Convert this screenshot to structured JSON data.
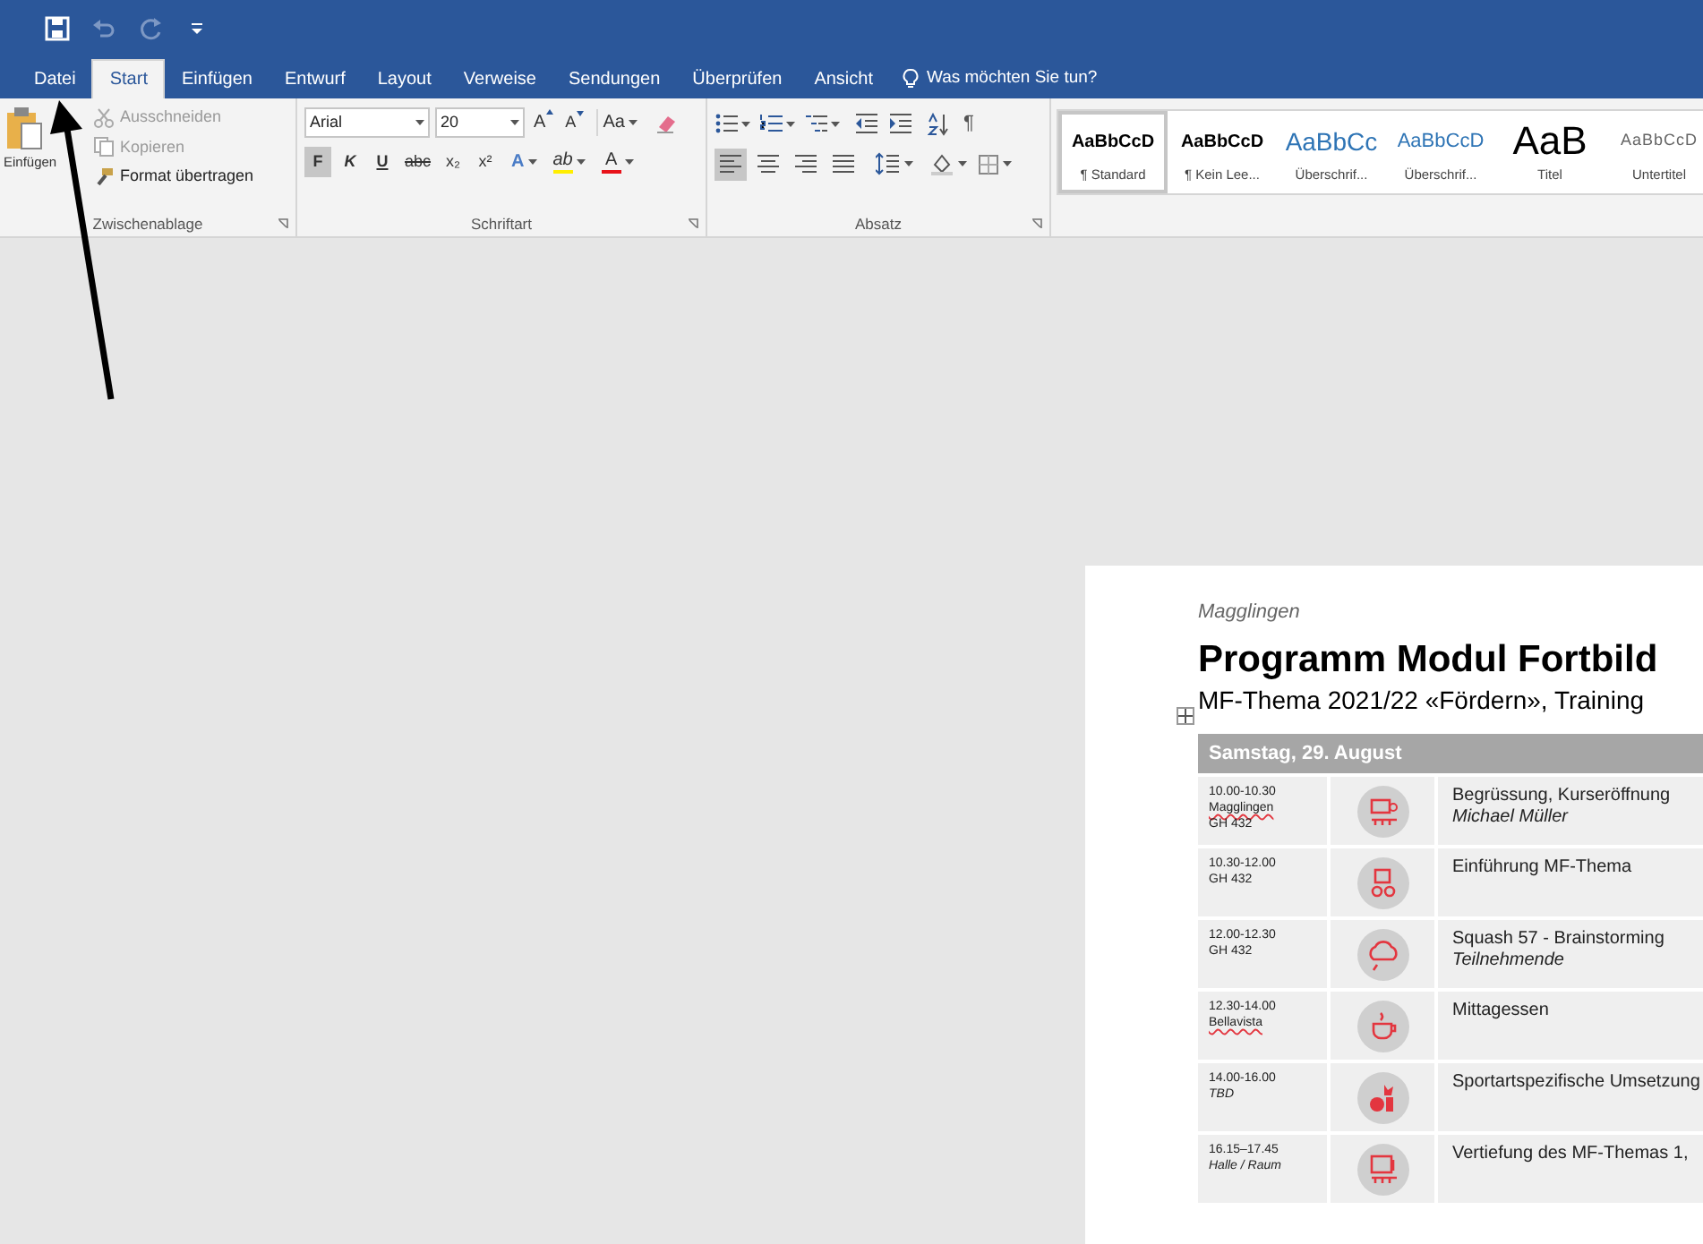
{
  "quick_access": [
    {
      "kind": "save",
      "disabled": false
    },
    {
      "kind": "undo",
      "disabled": true
    },
    {
      "kind": "redo",
      "disabled": true
    },
    {
      "kind": "customize",
      "disabled": false
    }
  ],
  "tabs": [
    {
      "label": "Datei",
      "selected": false
    },
    {
      "label": "Start",
      "selected": true
    },
    {
      "label": "Einfügen",
      "selected": false
    },
    {
      "label": "Entwurf",
      "selected": false
    },
    {
      "label": "Layout",
      "selected": false
    },
    {
      "label": "Verweise",
      "selected": false
    },
    {
      "label": "Sendungen",
      "selected": false
    },
    {
      "label": "Überprüfen",
      "selected": false
    },
    {
      "label": "Ansicht",
      "selected": false
    }
  ],
  "tell_me": "Was möchten Sie tun?",
  "clipboard": {
    "paste": "Einfügen",
    "items": [
      {
        "kind": "cut",
        "label": "Ausschneiden",
        "disabled": true
      },
      {
        "kind": "copy",
        "label": "Kopieren",
        "disabled": true
      },
      {
        "kind": "format_painter",
        "label": "Format übertragen",
        "disabled": false
      }
    ],
    "label": "Zwischenablage"
  },
  "font": {
    "name": "Arial",
    "size": "20",
    "size_buttons": [
      "A",
      "A"
    ],
    "case_button": "Aa",
    "format_buttons": [
      {
        "label": "F",
        "selected": true
      },
      {
        "label": "K",
        "selected": false
      },
      {
        "label": "U",
        "selected": false
      },
      {
        "label": "abc",
        "selected": false
      },
      {
        "label": "x₂",
        "selected": false
      },
      {
        "label": "x²",
        "selected": false
      }
    ],
    "effect_buttons": [
      {
        "kind": "text_effects",
        "label": "A"
      },
      {
        "kind": "highlight",
        "label": "ab"
      },
      {
        "kind": "font_color",
        "label": "A"
      }
    ],
    "label": "Schriftart"
  },
  "paragraph": {
    "show_marks": "¶",
    "alignments": [
      {
        "kind": "left",
        "selected": true
      },
      {
        "kind": "center",
        "selected": false
      },
      {
        "kind": "right",
        "selected": false
      },
      {
        "kind": "justify",
        "selected": false
      }
    ],
    "label": "Absatz"
  },
  "styles": [
    {
      "kind": "normal",
      "preview": "AaBbCcD",
      "name": "¶ Standard",
      "selected": true
    },
    {
      "kind": "no_spacing",
      "preview": "AaBbCcD",
      "name": "¶ Kein Lee...",
      "selected": false
    },
    {
      "kind": "heading1",
      "preview": "AaBbCc",
      "name": "Überschrif...",
      "selected": false
    },
    {
      "kind": "heading2",
      "preview": "AaBbCcD",
      "name": "Überschrif...",
      "selected": false
    },
    {
      "kind": "title",
      "preview": "AaB",
      "name": "Titel",
      "selected": false
    },
    {
      "kind": "subtitle",
      "preview": "AaBbCcD",
      "name": "Untertitel",
      "selected": false
    }
  ],
  "document": {
    "header": "Magglingen",
    "title": "Programm Modul Fortbild",
    "subtitle": "MF-Thema 2021/22 «Fördern», Training",
    "table": {
      "day": "Samstag, 29. August",
      "rows": [
        {
          "time": "10.00-10.30",
          "places": [
            {
              "text": "Magglingen",
              "italic": false,
              "misspelled": true
            },
            {
              "text": "GH 432",
              "italic": false,
              "misspelled": false
            }
          ],
          "title": "Begrüssung, Kurseröffnung",
          "person": "Michael Müller"
        },
        {
          "time": "10.30-12.00",
          "places": [
            {
              "text": "GH 432",
              "italic": false,
              "misspelled": false
            }
          ],
          "title": "Einführung MF-Thema"
        },
        {
          "time": "12.00-12.30",
          "places": [
            {
              "text": "GH 432",
              "italic": false,
              "misspelled": false
            }
          ],
          "title": "Squash 57 - Brainstorming",
          "person": "Teilnehmende"
        },
        {
          "time": "12.30-14.00",
          "places": [
            {
              "text": "Bellavista",
              "italic": false,
              "misspelled": true
            }
          ],
          "title": "Mittagessen"
        },
        {
          "time": "14.00-16.00",
          "places": [
            {
              "text": "TBD",
              "italic": true,
              "misspelled": false
            }
          ],
          "title": "Sportartspezifische Umsetzung"
        },
        {
          "time": "16.15–17.45",
          "places": [
            {
              "text": "Halle / Raum",
              "italic": true,
              "misspelled": false
            }
          ],
          "title": "Vertiefung des MF-Themas 1,"
        }
      ]
    }
  }
}
